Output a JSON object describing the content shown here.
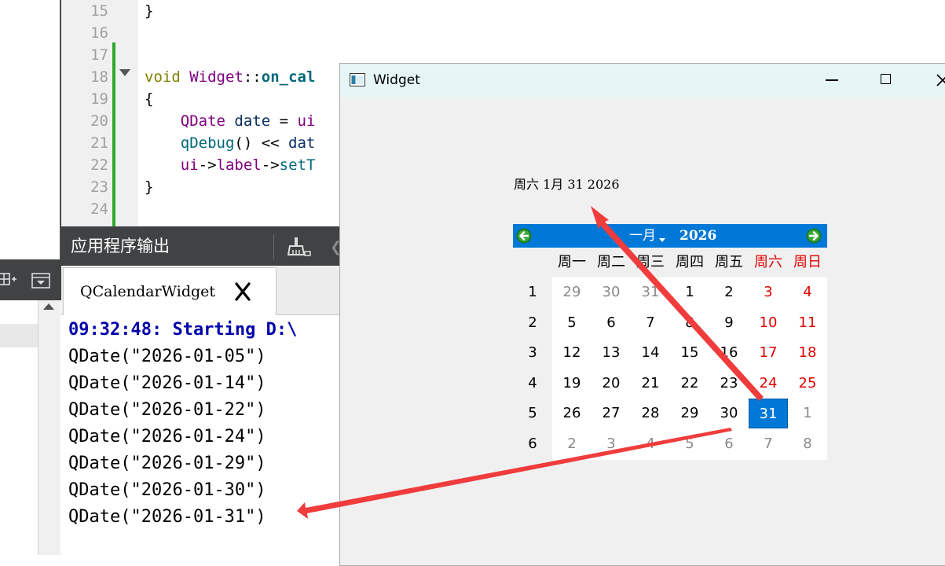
{
  "editor": {
    "line_numbers": [
      "15",
      "16",
      "17",
      "18",
      "19",
      "20",
      "21",
      "22",
      "23",
      "24"
    ],
    "lines": [
      [
        {
          "t": "}",
          "c": ""
        }
      ],
      [],
      [],
      [
        {
          "t": "void",
          "c": "kw"
        },
        {
          "t": " ",
          "c": ""
        },
        {
          "t": "Widget",
          "c": "cls"
        },
        {
          "t": "::",
          "c": ""
        },
        {
          "t": "on_cal",
          "c": "fn"
        }
      ],
      [
        {
          "t": "{",
          "c": ""
        }
      ],
      [
        {
          "t": "    ",
          "c": ""
        },
        {
          "t": "QDate",
          "c": "cls"
        },
        {
          "t": " ",
          "c": ""
        },
        {
          "t": "date",
          "c": "var"
        },
        {
          "t": " = ",
          "c": ""
        },
        {
          "t": "ui",
          "c": "cls"
        }
      ],
      [
        {
          "t": "    ",
          "c": ""
        },
        {
          "t": "qDebug",
          "c": "mth"
        },
        {
          "t": "() << ",
          "c": ""
        },
        {
          "t": "dat",
          "c": "var"
        }
      ],
      [
        {
          "t": "    ",
          "c": ""
        },
        {
          "t": "ui",
          "c": "cls"
        },
        {
          "t": "->",
          "c": ""
        },
        {
          "t": "label",
          "c": "cls"
        },
        {
          "t": "->",
          "c": ""
        },
        {
          "t": "setT",
          "c": "mth"
        }
      ],
      [
        {
          "t": "}",
          "c": ""
        }
      ],
      []
    ]
  },
  "output_pane": {
    "title": "应用程序输出",
    "tab_label": "QCalendarWidget",
    "lines": [
      "09:32:48: Starting D:\\",
      "QDate(\"2026-01-05\")",
      "QDate(\"2026-01-14\")",
      "QDate(\"2026-01-22\")",
      "QDate(\"2026-01-24\")",
      "QDate(\"2026-01-29\")",
      "QDate(\"2026-01-30\")",
      "QDate(\"2026-01-31\")"
    ]
  },
  "window": {
    "title": "Widget",
    "date_label": "周六 1月 31 2026",
    "calendar": {
      "month": "一月",
      "year": "2026",
      "weekdays": [
        "周一",
        "周二",
        "周三",
        "周四",
        "周五",
        "周六",
        "周日"
      ],
      "weeks": [
        {
          "num": "1",
          "days": [
            {
              "d": "29",
              "o": true
            },
            {
              "d": "30",
              "o": true
            },
            {
              "d": "31",
              "o": true
            },
            {
              "d": "1"
            },
            {
              "d": "2"
            },
            {
              "d": "3"
            },
            {
              "d": "4"
            }
          ]
        },
        {
          "num": "2",
          "days": [
            {
              "d": "5"
            },
            {
              "d": "6"
            },
            {
              "d": "7"
            },
            {
              "d": "8"
            },
            {
              "d": "9"
            },
            {
              "d": "10"
            },
            {
              "d": "11"
            }
          ]
        },
        {
          "num": "3",
          "days": [
            {
              "d": "12"
            },
            {
              "d": "13"
            },
            {
              "d": "14"
            },
            {
              "d": "15"
            },
            {
              "d": "16"
            },
            {
              "d": "17"
            },
            {
              "d": "18"
            }
          ]
        },
        {
          "num": "4",
          "days": [
            {
              "d": "19"
            },
            {
              "d": "20"
            },
            {
              "d": "21"
            },
            {
              "d": "22"
            },
            {
              "d": "23"
            },
            {
              "d": "24"
            },
            {
              "d": "25"
            }
          ]
        },
        {
          "num": "5",
          "days": [
            {
              "d": "26"
            },
            {
              "d": "27"
            },
            {
              "d": "28"
            },
            {
              "d": "29"
            },
            {
              "d": "30"
            },
            {
              "d": "31",
              "s": true
            },
            {
              "d": "1",
              "o": true
            }
          ]
        },
        {
          "num": "6",
          "days": [
            {
              "d": "2",
              "o": true
            },
            {
              "d": "3",
              "o": true
            },
            {
              "d": "4",
              "o": true
            },
            {
              "d": "5",
              "o": true
            },
            {
              "d": "6",
              "o": true
            },
            {
              "d": "7",
              "o": true
            },
            {
              "d": "8",
              "o": true
            }
          ]
        }
      ]
    }
  },
  "colors": {
    "accent": "#0078d7",
    "weekend": "#e00000",
    "annotation_arrow": "#f03c3c"
  }
}
